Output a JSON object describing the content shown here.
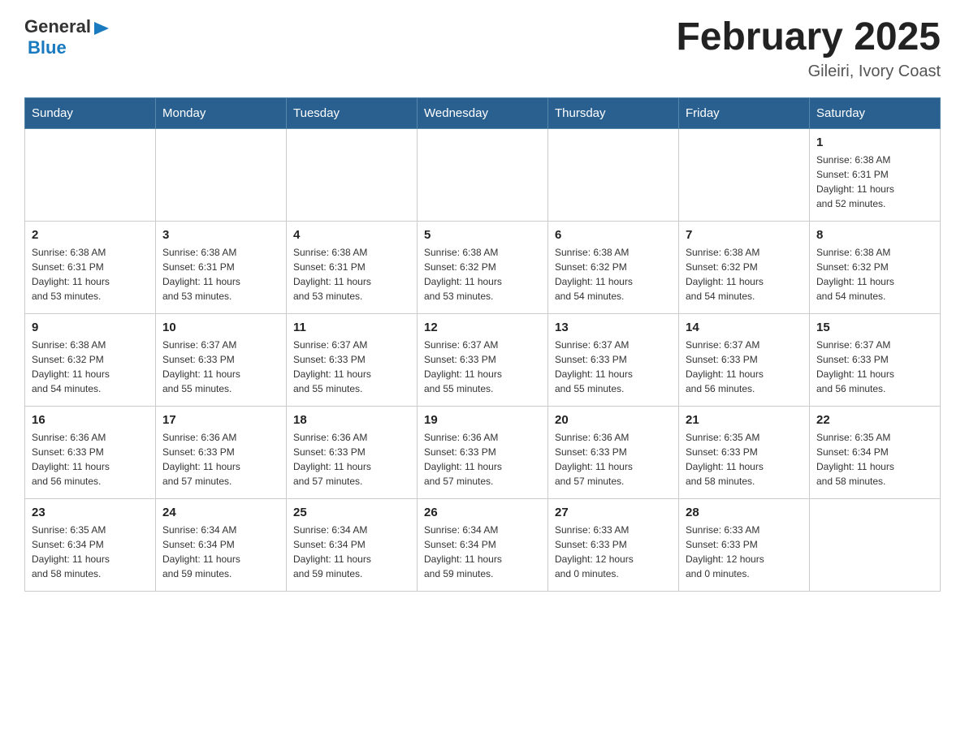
{
  "header": {
    "logo": {
      "general": "General",
      "arrow": "▶",
      "blue": "Blue"
    },
    "title": "February 2025",
    "subtitle": "Gileiri, Ivory Coast"
  },
  "days_of_week": [
    "Sunday",
    "Monday",
    "Tuesday",
    "Wednesday",
    "Thursday",
    "Friday",
    "Saturday"
  ],
  "weeks": [
    {
      "days": [
        {
          "number": "",
          "info": ""
        },
        {
          "number": "",
          "info": ""
        },
        {
          "number": "",
          "info": ""
        },
        {
          "number": "",
          "info": ""
        },
        {
          "number": "",
          "info": ""
        },
        {
          "number": "",
          "info": ""
        },
        {
          "number": "1",
          "info": "Sunrise: 6:38 AM\nSunset: 6:31 PM\nDaylight: 11 hours\nand 52 minutes."
        }
      ]
    },
    {
      "days": [
        {
          "number": "2",
          "info": "Sunrise: 6:38 AM\nSunset: 6:31 PM\nDaylight: 11 hours\nand 53 minutes."
        },
        {
          "number": "3",
          "info": "Sunrise: 6:38 AM\nSunset: 6:31 PM\nDaylight: 11 hours\nand 53 minutes."
        },
        {
          "number": "4",
          "info": "Sunrise: 6:38 AM\nSunset: 6:31 PM\nDaylight: 11 hours\nand 53 minutes."
        },
        {
          "number": "5",
          "info": "Sunrise: 6:38 AM\nSunset: 6:32 PM\nDaylight: 11 hours\nand 53 minutes."
        },
        {
          "number": "6",
          "info": "Sunrise: 6:38 AM\nSunset: 6:32 PM\nDaylight: 11 hours\nand 54 minutes."
        },
        {
          "number": "7",
          "info": "Sunrise: 6:38 AM\nSunset: 6:32 PM\nDaylight: 11 hours\nand 54 minutes."
        },
        {
          "number": "8",
          "info": "Sunrise: 6:38 AM\nSunset: 6:32 PM\nDaylight: 11 hours\nand 54 minutes."
        }
      ]
    },
    {
      "days": [
        {
          "number": "9",
          "info": "Sunrise: 6:38 AM\nSunset: 6:32 PM\nDaylight: 11 hours\nand 54 minutes."
        },
        {
          "number": "10",
          "info": "Sunrise: 6:37 AM\nSunset: 6:33 PM\nDaylight: 11 hours\nand 55 minutes."
        },
        {
          "number": "11",
          "info": "Sunrise: 6:37 AM\nSunset: 6:33 PM\nDaylight: 11 hours\nand 55 minutes."
        },
        {
          "number": "12",
          "info": "Sunrise: 6:37 AM\nSunset: 6:33 PM\nDaylight: 11 hours\nand 55 minutes."
        },
        {
          "number": "13",
          "info": "Sunrise: 6:37 AM\nSunset: 6:33 PM\nDaylight: 11 hours\nand 55 minutes."
        },
        {
          "number": "14",
          "info": "Sunrise: 6:37 AM\nSunset: 6:33 PM\nDaylight: 11 hours\nand 56 minutes."
        },
        {
          "number": "15",
          "info": "Sunrise: 6:37 AM\nSunset: 6:33 PM\nDaylight: 11 hours\nand 56 minutes."
        }
      ]
    },
    {
      "days": [
        {
          "number": "16",
          "info": "Sunrise: 6:36 AM\nSunset: 6:33 PM\nDaylight: 11 hours\nand 56 minutes."
        },
        {
          "number": "17",
          "info": "Sunrise: 6:36 AM\nSunset: 6:33 PM\nDaylight: 11 hours\nand 57 minutes."
        },
        {
          "number": "18",
          "info": "Sunrise: 6:36 AM\nSunset: 6:33 PM\nDaylight: 11 hours\nand 57 minutes."
        },
        {
          "number": "19",
          "info": "Sunrise: 6:36 AM\nSunset: 6:33 PM\nDaylight: 11 hours\nand 57 minutes."
        },
        {
          "number": "20",
          "info": "Sunrise: 6:36 AM\nSunset: 6:33 PM\nDaylight: 11 hours\nand 57 minutes."
        },
        {
          "number": "21",
          "info": "Sunrise: 6:35 AM\nSunset: 6:33 PM\nDaylight: 11 hours\nand 58 minutes."
        },
        {
          "number": "22",
          "info": "Sunrise: 6:35 AM\nSunset: 6:34 PM\nDaylight: 11 hours\nand 58 minutes."
        }
      ]
    },
    {
      "days": [
        {
          "number": "23",
          "info": "Sunrise: 6:35 AM\nSunset: 6:34 PM\nDaylight: 11 hours\nand 58 minutes."
        },
        {
          "number": "24",
          "info": "Sunrise: 6:34 AM\nSunset: 6:34 PM\nDaylight: 11 hours\nand 59 minutes."
        },
        {
          "number": "25",
          "info": "Sunrise: 6:34 AM\nSunset: 6:34 PM\nDaylight: 11 hours\nand 59 minutes."
        },
        {
          "number": "26",
          "info": "Sunrise: 6:34 AM\nSunset: 6:34 PM\nDaylight: 11 hours\nand 59 minutes."
        },
        {
          "number": "27",
          "info": "Sunrise: 6:33 AM\nSunset: 6:33 PM\nDaylight: 12 hours\nand 0 minutes."
        },
        {
          "number": "28",
          "info": "Sunrise: 6:33 AM\nSunset: 6:33 PM\nDaylight: 12 hours\nand 0 minutes."
        },
        {
          "number": "",
          "info": ""
        }
      ]
    }
  ]
}
